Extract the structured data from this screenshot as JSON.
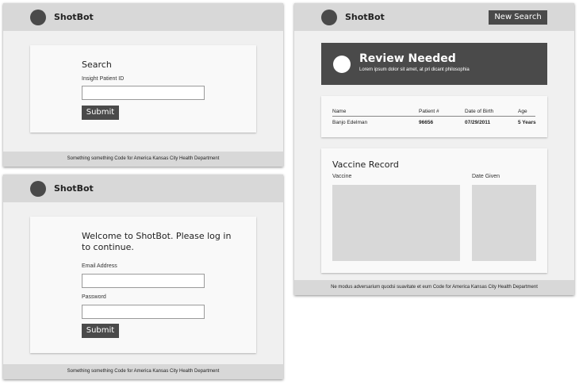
{
  "search_window": {
    "app_title": "ShotBot",
    "card_title": "Search",
    "field_label": "Insight Patient ID",
    "field_value": "",
    "submit_label": "Submit",
    "footer": "Something something Code for America Kansas City Health Department"
  },
  "login_window": {
    "app_title": "ShotBot",
    "card_title_line1": "Welcome to ShotBot. Please log in",
    "card_title_line2": "to continue.",
    "email_label": "Email Address",
    "email_value": "",
    "password_label": "Password",
    "password_value": "",
    "submit_label": "Submit",
    "footer": "Something something Code for America Kansas City Health Department"
  },
  "review_window": {
    "app_title": "ShotBot",
    "new_search_label": "New Search",
    "banner": {
      "title": "Review Needed",
      "subtitle": "Lorem ipsum dolor sit amet, at pri dicant philosophia"
    },
    "patient_table": {
      "columns": [
        "Name",
        "Patient #",
        "Date of Birth",
        "Age"
      ],
      "rows": [
        [
          "Banjo Edelman",
          "96656",
          "07/29/2011",
          "5 Years"
        ]
      ]
    },
    "vaccine_record": {
      "title": "Vaccine Record",
      "col_vaccine": "Vaccine",
      "col_date": "Date Given"
    },
    "footer": "Ne modus adversarium quodsi suavitate et eum Code for America Kansas City Health Department"
  },
  "colors": {
    "header_bar": "#d8d8d8",
    "window_bg": "#f0f0f0",
    "card_bg": "#f9f9f9",
    "button_dark": "#4a4a4a",
    "placeholder_gray": "#d8d8d8"
  },
  "icons": [
    "logo-circle-icon",
    "alert-circle-icon"
  ]
}
